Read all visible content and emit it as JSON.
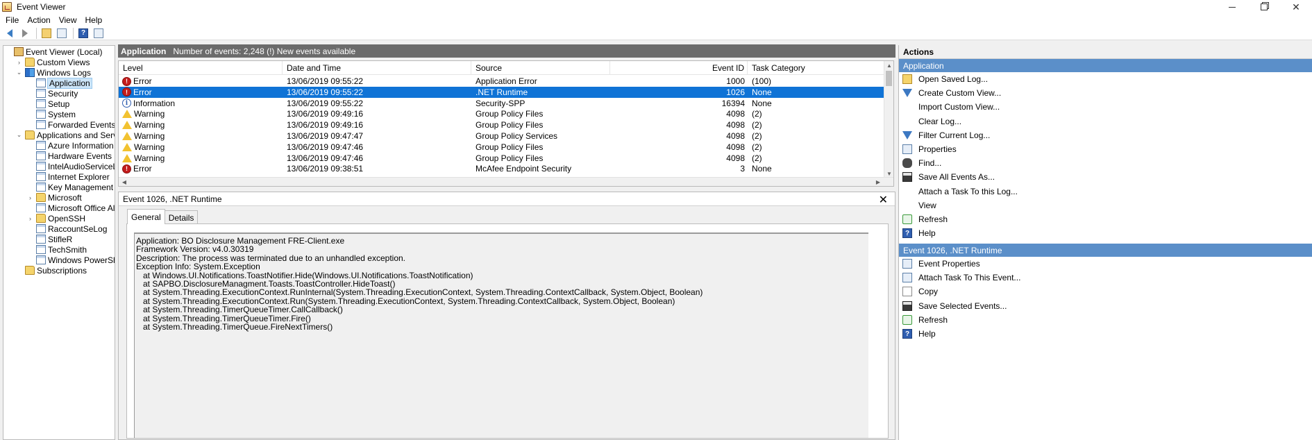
{
  "window": {
    "title": "Event Viewer",
    "controls": {
      "minimize": "",
      "maximize": "",
      "close": "✕"
    }
  },
  "menu": [
    {
      "label": "File"
    },
    {
      "label": "Action"
    },
    {
      "label": "View"
    },
    {
      "label": "Help"
    }
  ],
  "toolbar": {
    "buttons": [
      "back-icon",
      "forward-icon",
      "open-folder-icon",
      "console-tree-icon",
      "help-icon",
      "show-action-pane-icon"
    ]
  },
  "tree": {
    "items": [
      {
        "label": "Event Viewer (Local)",
        "icon": "event-viewer-icon",
        "twisty": "",
        "indent": 0
      },
      {
        "label": "Custom Views",
        "icon": "folder-icon",
        "twisty": "›",
        "indent": 1
      },
      {
        "label": "Windows Logs",
        "icon": "windows-logs-icon",
        "twisty": "⌄",
        "indent": 1
      },
      {
        "label": "Application",
        "icon": "log-icon",
        "twisty": "",
        "indent": 2,
        "selected": true
      },
      {
        "label": "Security",
        "icon": "log-icon",
        "twisty": "",
        "indent": 2
      },
      {
        "label": "Setup",
        "icon": "log-icon",
        "twisty": "",
        "indent": 2
      },
      {
        "label": "System",
        "icon": "log-icon",
        "twisty": "",
        "indent": 2
      },
      {
        "label": "Forwarded Events",
        "icon": "log-icon",
        "twisty": "",
        "indent": 2
      },
      {
        "label": "Applications and Services Lo",
        "icon": "folder-icon",
        "twisty": "⌄",
        "indent": 1
      },
      {
        "label": "Azure Information Protec",
        "icon": "log-icon",
        "twisty": "",
        "indent": 2
      },
      {
        "label": "Hardware Events",
        "icon": "log-icon",
        "twisty": "",
        "indent": 2
      },
      {
        "label": "IntelAudioServiceLog",
        "icon": "log-icon",
        "twisty": "",
        "indent": 2
      },
      {
        "label": "Internet Explorer",
        "icon": "log-icon",
        "twisty": "",
        "indent": 2
      },
      {
        "label": "Key Management Service",
        "icon": "log-icon",
        "twisty": "",
        "indent": 2
      },
      {
        "label": "Microsoft",
        "icon": "folder-icon",
        "twisty": "›",
        "indent": 2
      },
      {
        "label": "Microsoft Office Alerts",
        "icon": "log-icon",
        "twisty": "",
        "indent": 2
      },
      {
        "label": "OpenSSH",
        "icon": "folder-icon",
        "twisty": "›",
        "indent": 2
      },
      {
        "label": "RaccountSeLog",
        "icon": "log-icon",
        "twisty": "",
        "indent": 2
      },
      {
        "label": "StifleR",
        "icon": "log-icon",
        "twisty": "",
        "indent": 2
      },
      {
        "label": "TechSmith",
        "icon": "log-icon",
        "twisty": "",
        "indent": 2
      },
      {
        "label": "Windows PowerShell",
        "icon": "log-icon",
        "twisty": "",
        "indent": 2
      },
      {
        "label": "Subscriptions",
        "icon": "folder-icon",
        "twisty": "",
        "indent": 1
      }
    ]
  },
  "list_header": {
    "title": "Application",
    "info": "Number of events: 2,248 (!) New events available"
  },
  "columns": {
    "level": "Level",
    "datetime": "Date and Time",
    "source": "Source",
    "eventid": "Event ID",
    "category": "Task Category"
  },
  "events": [
    {
      "level": "Error",
      "type": "error",
      "datetime": "13/06/2019 09:55:22",
      "source": "Application Error",
      "eventid": "1000",
      "category": "(100)"
    },
    {
      "level": "Error",
      "type": "error",
      "datetime": "13/06/2019 09:55:22",
      "source": ".NET Runtime",
      "eventid": "1026",
      "category": "None",
      "selected": true
    },
    {
      "level": "Information",
      "type": "info",
      "datetime": "13/06/2019 09:55:22",
      "source": "Security-SPP",
      "eventid": "16394",
      "category": "None"
    },
    {
      "level": "Warning",
      "type": "warn",
      "datetime": "13/06/2019 09:49:16",
      "source": "Group Policy Files",
      "eventid": "4098",
      "category": "(2)"
    },
    {
      "level": "Warning",
      "type": "warn",
      "datetime": "13/06/2019 09:49:16",
      "source": "Group Policy Files",
      "eventid": "4098",
      "category": "(2)"
    },
    {
      "level": "Warning",
      "type": "warn",
      "datetime": "13/06/2019 09:47:47",
      "source": "Group Policy Services",
      "eventid": "4098",
      "category": "(2)"
    },
    {
      "level": "Warning",
      "type": "warn",
      "datetime": "13/06/2019 09:47:46",
      "source": "Group Policy Files",
      "eventid": "4098",
      "category": "(2)"
    },
    {
      "level": "Warning",
      "type": "warn",
      "datetime": "13/06/2019 09:47:46",
      "source": "Group Policy Files",
      "eventid": "4098",
      "category": "(2)"
    },
    {
      "level": "Error",
      "type": "error",
      "datetime": "13/06/2019 09:38:51",
      "source": "McAfee Endpoint Security",
      "eventid": "3",
      "category": "None"
    }
  ],
  "details": {
    "title": "Event 1026, .NET Runtime",
    "close_label": "✕",
    "tabs": [
      {
        "label": "General",
        "active": true
      },
      {
        "label": "Details",
        "active": false
      }
    ],
    "lines": [
      "Application: BO Disclosure Management FRE-Client.exe",
      "Framework Version: v4.0.30319",
      "Description: The process was terminated due to an unhandled exception.",
      "Exception Info: System.Exception",
      "   at Windows.UI.Notifications.ToastNotifier.Hide(Windows.UI.Notifications.ToastNotification)",
      "   at SAPBO.DisclosureManagment.Toasts.ToastController.HideToast()",
      "   at System.Threading.ExecutionContext.RunInternal(System.Threading.ExecutionContext, System.Threading.ContextCallback, System.Object, Boolean)",
      "   at System.Threading.ExecutionContext.Run(System.Threading.ExecutionContext, System.Threading.ContextCallback, System.Object, Boolean)",
      "   at System.Threading.TimerQueueTimer.CallCallback()",
      "   at System.Threading.TimerQueueTimer.Fire()",
      "   at System.Threading.TimerQueue.FireNextTimers()"
    ]
  },
  "actions": {
    "title": "Actions",
    "sections": [
      {
        "title": "Application",
        "items": [
          {
            "label": "Open Saved Log...",
            "icon": "open-saved-log-icon"
          },
          {
            "label": "Create Custom View...",
            "icon": "filter-icon"
          },
          {
            "label": "Import Custom View...",
            "icon": ""
          },
          {
            "label": "Clear Log...",
            "icon": ""
          },
          {
            "label": "Filter Current Log...",
            "icon": "filter-icon"
          },
          {
            "label": "Properties",
            "icon": "properties-icon"
          },
          {
            "label": "Find...",
            "icon": "find-icon"
          },
          {
            "label": "Save All Events As...",
            "icon": "save-icon"
          },
          {
            "label": "Attach a Task To this Log...",
            "icon": ""
          },
          {
            "label": "View",
            "icon": ""
          },
          {
            "label": "Refresh",
            "icon": "refresh-icon"
          },
          {
            "label": "Help",
            "icon": "help-icon"
          }
        ]
      },
      {
        "title": "Event 1026, .NET Runtime",
        "items": [
          {
            "label": "Event Properties",
            "icon": "properties-icon"
          },
          {
            "label": "Attach Task To This Event...",
            "icon": "attach-task-icon"
          },
          {
            "label": "Copy",
            "icon": "copy-icon"
          },
          {
            "label": "Save Selected Events...",
            "icon": "save-icon"
          },
          {
            "label": "Refresh",
            "icon": "refresh-icon"
          },
          {
            "label": "Help",
            "icon": "help-icon"
          }
        ]
      }
    ]
  }
}
